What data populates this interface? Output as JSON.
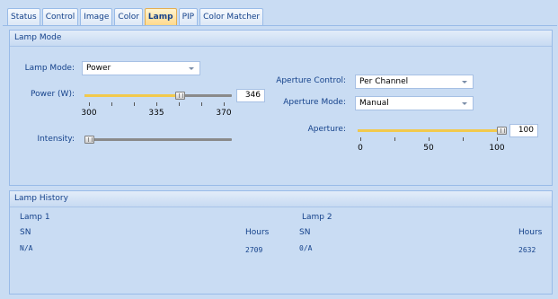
{
  "tabs": [
    {
      "label": "Status",
      "active": false
    },
    {
      "label": "Control",
      "active": false
    },
    {
      "label": "Image",
      "active": false
    },
    {
      "label": "Color",
      "active": false
    },
    {
      "label": "Lamp",
      "active": true
    },
    {
      "label": "PIP",
      "active": false
    },
    {
      "label": "Color Matcher",
      "active": false
    }
  ],
  "lamp_mode": {
    "header": "Lamp Mode",
    "lamp_mode_label": "Lamp Mode:",
    "lamp_mode_value": "Power",
    "power_label": "Power (W):",
    "power_value": "346",
    "power_ticks": [
      "300",
      "335",
      "370"
    ],
    "power_level": 0.66,
    "intensity_label": "Intensity:",
    "intensity_level": 0.0,
    "aperture_control_label": "Aperture Control:",
    "aperture_control_value": "Per Channel",
    "aperture_mode_label": "Aperture Mode:",
    "aperture_mode_value": "Manual",
    "aperture_label": "Aperture:",
    "aperture_value": "100",
    "aperture_ticks": [
      "0",
      "50",
      "100"
    ],
    "aperture_level": 1.0
  },
  "lamp_history": {
    "header": "Lamp History",
    "lamp1": {
      "title": "Lamp 1",
      "sn_label": "SN",
      "hours_label": "Hours",
      "sn": "N/A",
      "hours": "2709"
    },
    "lamp2": {
      "title": "Lamp 2",
      "sn_label": "SN",
      "hours_label": "Hours",
      "sn": "0/A",
      "hours": "2632"
    }
  },
  "colors": {
    "accent": "#15428b",
    "slider_fill": "#f2c94c",
    "active_tab": "#ffd889"
  }
}
